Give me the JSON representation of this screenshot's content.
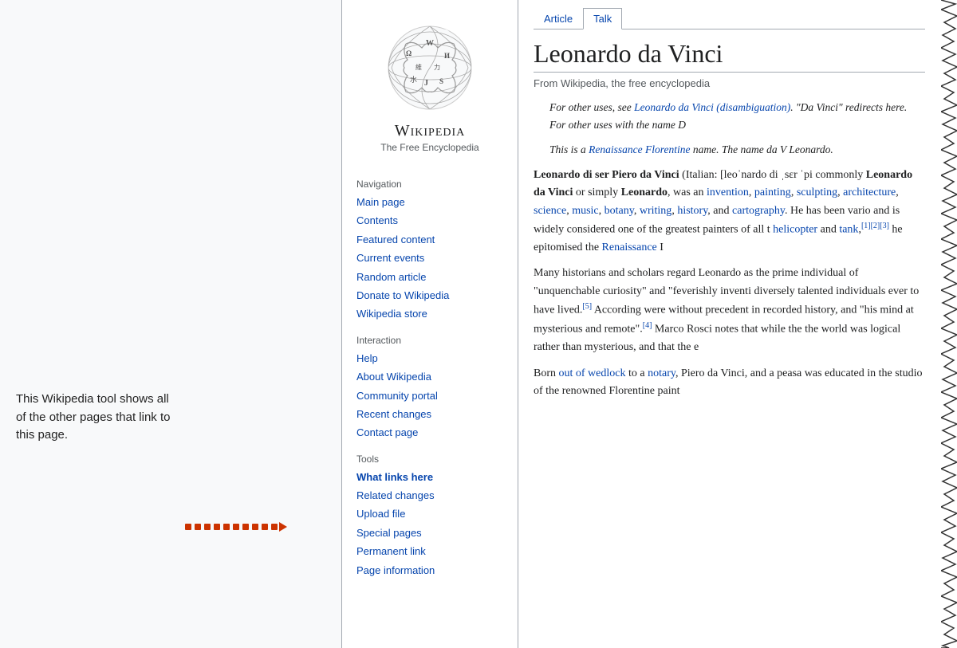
{
  "annotation": {
    "text": "This Wikipedia tool shows all of the other pages that link to this page."
  },
  "arrow": {
    "dot_count": 10
  },
  "wiki": {
    "logo_alt": "Wikipedia globe logo",
    "site_name": "Wikipedia",
    "tagline": "The Free Encyclopedia",
    "tabs": [
      {
        "label": "Article",
        "active": false
      },
      {
        "label": "Talk",
        "active": true
      }
    ],
    "article_title": "Leonardo da Vinci",
    "article_subtitle": "From Wikipedia, the free encyclopedia",
    "sidebar": {
      "navigation_header": "Navigation",
      "nav_links": [
        {
          "label": "Main page",
          "id": "main-page"
        },
        {
          "label": "Contents",
          "id": "contents"
        },
        {
          "label": "Featured content",
          "id": "featured-content"
        },
        {
          "label": "Current events",
          "id": "current-events"
        },
        {
          "label": "Random article",
          "id": "random-article"
        },
        {
          "label": "Donate to Wikipedia",
          "id": "donate"
        },
        {
          "label": "Wikipedia store",
          "id": "store"
        }
      ],
      "interaction_header": "Interaction",
      "interaction_links": [
        {
          "label": "Help",
          "id": "help"
        },
        {
          "label": "About Wikipedia",
          "id": "about"
        },
        {
          "label": "Community portal",
          "id": "community"
        },
        {
          "label": "Recent changes",
          "id": "recent-changes"
        },
        {
          "label": "Contact page",
          "id": "contact"
        }
      ],
      "tools_header": "Tools",
      "tools_links": [
        {
          "label": "What links here",
          "id": "what-links-here",
          "highlighted": true
        },
        {
          "label": "Related changes",
          "id": "related-changes"
        },
        {
          "label": "Upload file",
          "id": "upload-file"
        },
        {
          "label": "Special pages",
          "id": "special-pages"
        },
        {
          "label": "Permanent link",
          "id": "permanent-link"
        },
        {
          "label": "Page information",
          "id": "page-information"
        }
      ]
    },
    "content": {
      "hatnote1": "For other uses, see Leonardo da Vinci (disambiguation). \"Da Vinci\" redirects here. For other uses with the name D",
      "hatnote2": "This is a Renaissance Florentine name. The name da V Leonardo.",
      "para1": "Leonardo di ser Piero da Vinci (Italian: [leoˈnardo di ˌsɛr ˈpi commonly Leonardo da Vinci or simply Leonardo, was an invention, painting, sculpting, architecture, science, music, botany, writing, history, and cartography. He has been vario and is widely considered one of the greatest painters of all t helicopter and tank,[1][2][3] he epitomised the Renaissance I",
      "para2": "Many historians and scholars regard Leonardo as the prime individual of \"unquenchable curiosity\" and \"feverishly inventi diversely talented individuals ever to have lived.[5] According were without precedent in recorded history, and \"his mind at mysterious and remote\".[4] Marco Rosci notes that while the the world was logical rather than mysterious, and that the e",
      "para3": "Born out of wedlock to a notary, Piero da Vinci, and a peasa was educated in the studio of the renowned Florentine paint"
    }
  }
}
